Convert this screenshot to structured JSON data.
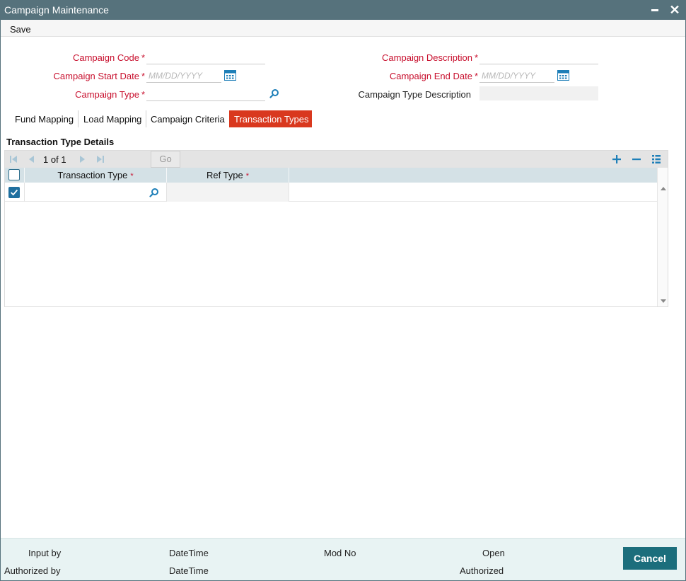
{
  "window": {
    "title": "Campaign Maintenance"
  },
  "menu": {
    "save_label": "Save"
  },
  "form": {
    "campaign_code": {
      "label": "Campaign Code",
      "required": "*",
      "value": ""
    },
    "campaign_description": {
      "label": "Campaign Description",
      "required": "*",
      "value": ""
    },
    "campaign_start_date": {
      "label": "Campaign Start Date",
      "required": "*",
      "placeholder": "MM/DD/YYYY"
    },
    "campaign_end_date": {
      "label": "Campaign End Date",
      "required": "*",
      "placeholder": "MM/DD/YYYY"
    },
    "campaign_type": {
      "label": "Campaign Type",
      "required": "*",
      "value": ""
    },
    "campaign_type_description": {
      "label": "Campaign Type Description",
      "value": ""
    }
  },
  "tabs": [
    {
      "label": "Fund Mapping",
      "active": false
    },
    {
      "label": "Load Mapping",
      "active": false
    },
    {
      "label": "Campaign Criteria",
      "active": false
    },
    {
      "label": "Transaction Types",
      "active": true
    }
  ],
  "section": {
    "title": "Transaction Type Details"
  },
  "pager": {
    "current": "1",
    "of_label": "of",
    "total": "1",
    "go_label": "Go"
  },
  "grid": {
    "columns": [
      {
        "label": "Transaction Type",
        "required": "*"
      },
      {
        "label": "Ref Type",
        "required": "*"
      }
    ],
    "rows": [
      {
        "checked": true,
        "transaction_type": "",
        "ref_type": ""
      }
    ]
  },
  "footer": {
    "input_by": "Input by",
    "authorized_by": "Authorized by",
    "datetime_1": "DateTime",
    "datetime_2": "DateTime",
    "mod_no": "Mod No",
    "open": "Open",
    "authorized": "Authorized",
    "cancel_label": "Cancel"
  },
  "colors": {
    "titlebar": "#56727c",
    "required_label": "#c8102e",
    "active_tab": "#d9381e",
    "grid_header": "#d4e1e6",
    "footer_bg": "#e8f3f3",
    "cancel_button": "#1c6e7c",
    "icon_blue": "#1e7fb8"
  },
  "icons": {
    "calendar": "calendar-icon",
    "search": "search-icon",
    "add": "add-row-icon",
    "remove": "delete-row-icon",
    "columns": "column-settings-icon"
  }
}
